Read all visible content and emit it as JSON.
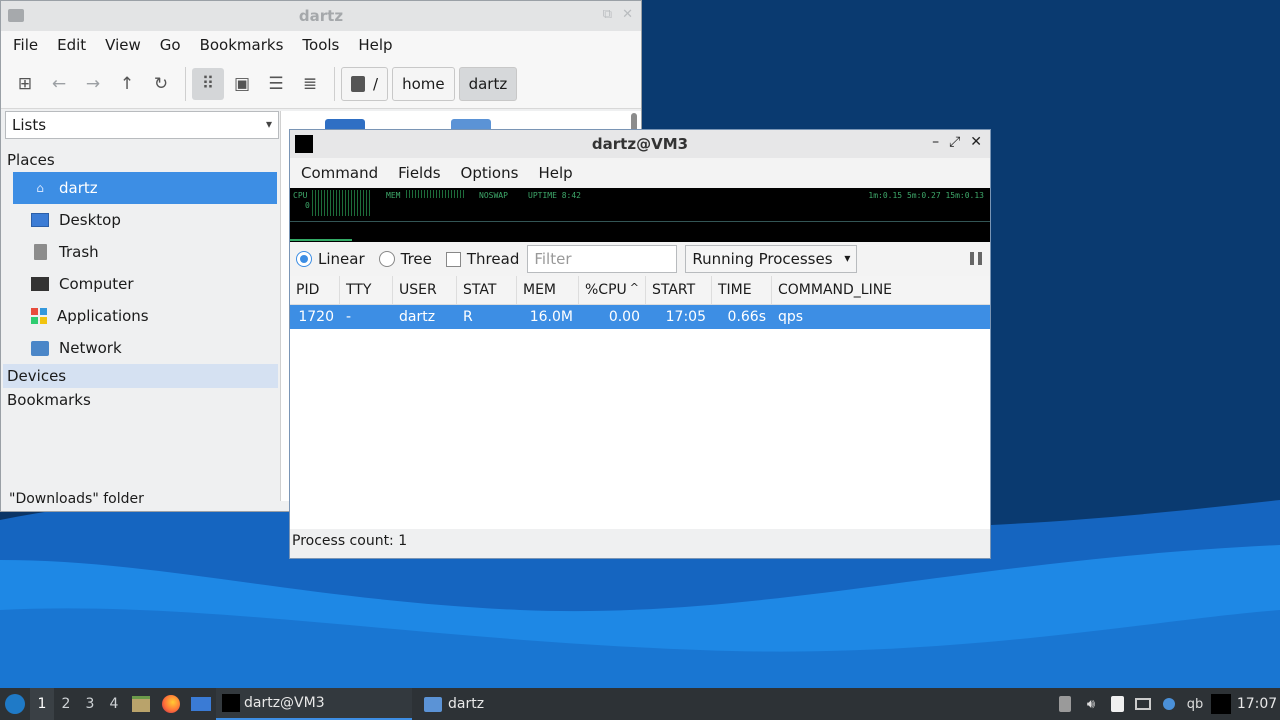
{
  "file_manager": {
    "title": "dartz",
    "menu": [
      "File",
      "Edit",
      "View",
      "Go",
      "Bookmarks",
      "Tools",
      "Help"
    ],
    "path": [
      "/",
      "home",
      "dartz"
    ],
    "side_combo": "Lists",
    "places_header": "Places",
    "places": [
      "dartz",
      "Desktop",
      "Trash",
      "Computer",
      "Applications",
      "Network"
    ],
    "devices_header": "Devices",
    "bookmarks_header": "Bookmarks",
    "status": "\"Downloads\" folder"
  },
  "qps": {
    "title": "dartz@VM3",
    "menu": [
      "Command",
      "Fields",
      "Options",
      "Help"
    ],
    "meter": {
      "cpu_label": "CPU",
      "cpu_value": "0",
      "mem_label": "MEM",
      "swap_label": "NOSWAP",
      "uptime": "UPTIME 8:42",
      "load": "1m:0.15 5m:0.27 15m:0.13"
    },
    "view_modes": [
      "Linear",
      "Tree",
      "Thread"
    ],
    "filter_placeholder": "Filter",
    "process_filter": "Running Processes",
    "columns": [
      "PID",
      "TTY",
      "USER",
      "STAT",
      "MEM",
      "%CPU",
      "START",
      "TIME",
      "COMMAND_LINE"
    ],
    "rows": [
      [
        "1720",
        "-",
        "dartz",
        "R",
        "16.0M",
        "0.00",
        "17:05",
        "0.66s",
        "qps"
      ]
    ],
    "status": "Process count: 1"
  },
  "taskbar": {
    "workspaces": [
      "1",
      "2",
      "3",
      "4"
    ],
    "tasks": [
      "dartz@VM3",
      "dartz"
    ],
    "tray_text": "qb",
    "clock": "17:07"
  },
  "colors": {
    "selection": "#3d8ee4",
    "taskbar": "#2d3236",
    "meter_green": "#3ea86a"
  }
}
